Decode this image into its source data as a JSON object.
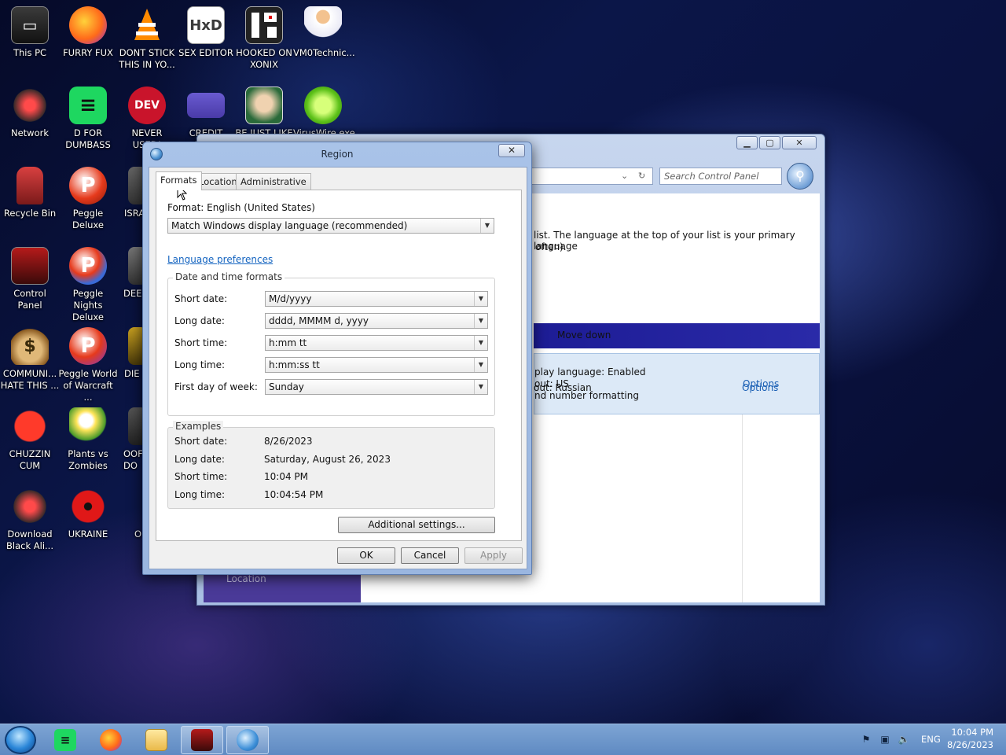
{
  "desktop": {
    "icons": [
      {
        "label": "This PC"
      },
      {
        "label": "FURRY FUX"
      },
      {
        "label": "DONT STICK THIS IN YO..."
      },
      {
        "label": "SEX EDITOR"
      },
      {
        "label": "HOOKED ON XONIX"
      },
      {
        "label": "VM0Technic..."
      },
      {
        "label": "Network"
      },
      {
        "label": "D FOR DUMBASS"
      },
      {
        "label": "NEVER USED!"
      },
      {
        "label": "CREDIT CARD"
      },
      {
        "label": "BE JUST LIKE"
      },
      {
        "label": "VirusWire.exe"
      },
      {
        "label": "Recycle Bin"
      },
      {
        "label": "Peggle Deluxe"
      },
      {
        "label": "ISRA"
      },
      {
        "label": "Control Panel"
      },
      {
        "label": "Peggle Nights Deluxe"
      },
      {
        "label": "DEE"
      },
      {
        "label": "COMMUNI... HATE THIS ..."
      },
      {
        "label": "Peggle World of Warcraft ..."
      },
      {
        "label": "DIE"
      },
      {
        "label": "CHUZZIN CUM"
      },
      {
        "label": "Plants vs Zombies"
      },
      {
        "label": "OOF DO"
      },
      {
        "label": "Download Black Ali..."
      },
      {
        "label": "UKRAINE"
      },
      {
        "label": "O"
      }
    ]
  },
  "control_panel": {
    "search_placeholder": "Search Control Panel",
    "description_line1": "list. The language at the top of your list is your primary language",
    "description_line2": "often).",
    "move_down": "Move down",
    "lang1_line1": "play language: Enabled",
    "lang1_line2": "out: US",
    "lang1_line3": "nd number formatting",
    "lang2_line1": "out: Russian",
    "options_label": "Options",
    "location_label": "Location"
  },
  "dialog": {
    "title": "Region",
    "tabs": [
      "Formats",
      "Location",
      "Administrative"
    ],
    "format_label": "Format: English (United States)",
    "format_value": "Match Windows display language (recommended)",
    "language_preferences_link": "Language preferences",
    "date_time_group": "Date and time formats",
    "fields": [
      {
        "label": "Short date:",
        "value": "M/d/yyyy"
      },
      {
        "label": "Long date:",
        "value": "dddd, MMMM d, yyyy"
      },
      {
        "label": "Short time:",
        "value": "h:mm tt"
      },
      {
        "label": "Long time:",
        "value": "h:mm:ss tt"
      },
      {
        "label": "First day of week:",
        "value": "Sunday"
      }
    ],
    "examples_group": "Examples",
    "examples": [
      {
        "label": "Short date:",
        "value": "8/26/2023"
      },
      {
        "label": "Long date:",
        "value": "Saturday, August 26, 2023"
      },
      {
        "label": "Short time:",
        "value": "10:04 PM"
      },
      {
        "label": "Long time:",
        "value": "10:04:54 PM"
      }
    ],
    "additional_settings": "Additional settings...",
    "ok": "OK",
    "cancel": "Cancel",
    "apply": "Apply"
  },
  "taskbar": {
    "language": "ENG",
    "time": "10:04 PM",
    "date": "8/26/2023"
  }
}
